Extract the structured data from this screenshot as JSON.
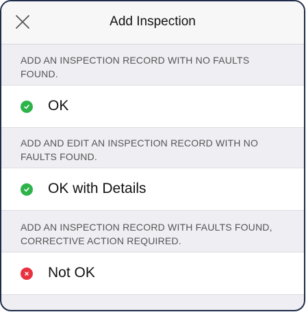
{
  "header": {
    "title": "Add Inspection",
    "close_icon": "close-icon"
  },
  "sections": [
    {
      "description": "ADD AN INSPECTION RECORD WITH NO FAULTS FOUND.",
      "option_label": "OK",
      "status_color": "#2db34a",
      "icon": "check-icon"
    },
    {
      "description": "ADD AND EDIT AN INSPECTION RECORD WITH NO FAULTS FOUND.",
      "option_label": "OK with Details",
      "status_color": "#2db34a",
      "icon": "check-icon"
    },
    {
      "description": "ADD AN INSPECTION RECORD WITH FAULTS FOUND, CORRECTIVE ACTION REQUIRED.",
      "option_label": "Not OK",
      "status_color": "#e8323f",
      "icon": "x-icon"
    }
  ],
  "colors": {
    "frame_border": "#1f2b4a",
    "background": "#eeeef3",
    "ok_green": "#2db34a",
    "not_ok_red": "#e8323f"
  }
}
